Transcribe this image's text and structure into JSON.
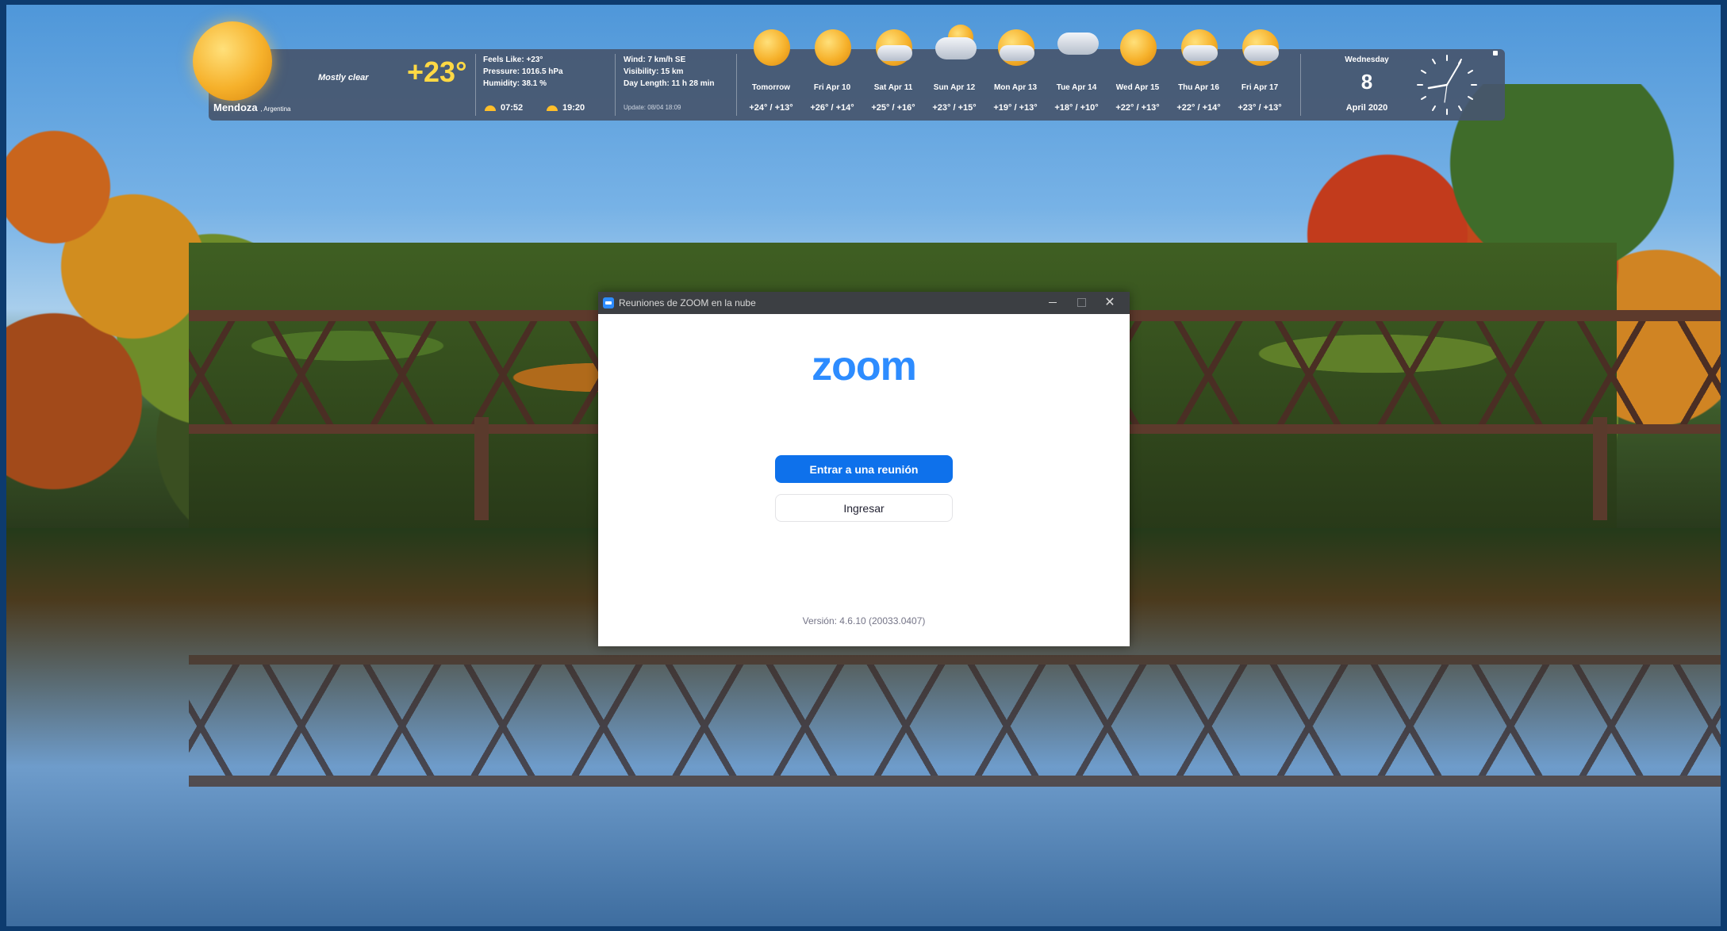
{
  "weather": {
    "location": "Mendoza",
    "country": ", Argentina",
    "condition": "Mostly clear",
    "temperature": "+23°",
    "feels_like": "Feels Like: +23°",
    "pressure": "Pressure: 1016.5 hPa",
    "humidity": "Humidity: 38.1 %",
    "wind": "Wind: 7 km/h   SE",
    "visibility": "Visibility: 15 km",
    "day_length": "Day Length: 11 h 28 min",
    "sunrise": "07:52",
    "sunset": "19:20",
    "update": "Update: 08/04 18:09",
    "forecast": [
      {
        "day": "Tomorrow",
        "range": "+24° / +13°",
        "icon": "sun"
      },
      {
        "day": "Fri Apr 10",
        "range": "+26° / +14°",
        "icon": "sun"
      },
      {
        "day": "Sat Apr 11",
        "range": "+25° / +16°",
        "icon": "sun-cloud"
      },
      {
        "day": "Sun Apr 12",
        "range": "+23° / +15°",
        "icon": "cloud-sun"
      },
      {
        "day": "Mon Apr 13",
        "range": "+19° / +13°",
        "icon": "sun-cloud"
      },
      {
        "day": "Tue Apr 14",
        "range": "+18° / +10°",
        "icon": "cloud"
      },
      {
        "day": "Wed Apr 15",
        "range": "+22° / +13°",
        "icon": "sun"
      },
      {
        "day": "Thu Apr 16",
        "range": "+22° / +14°",
        "icon": "sun-cloud"
      },
      {
        "day": "Fri Apr 17",
        "range": "+23° / +13°",
        "icon": "sun-cloud"
      }
    ],
    "date": {
      "weekday": "Wednesday",
      "day": "8",
      "month_year": "April 2020"
    }
  },
  "zoom": {
    "window_title": "Reuniones de ZOOM en la nube",
    "logo_text": "zoom",
    "join_label": "Entrar a una reunión",
    "signin_label": "Ingresar",
    "version": "Versión: 4.6.10 (20033.0407)",
    "accent": "#0e71eb",
    "brand": "#2d8cff"
  }
}
